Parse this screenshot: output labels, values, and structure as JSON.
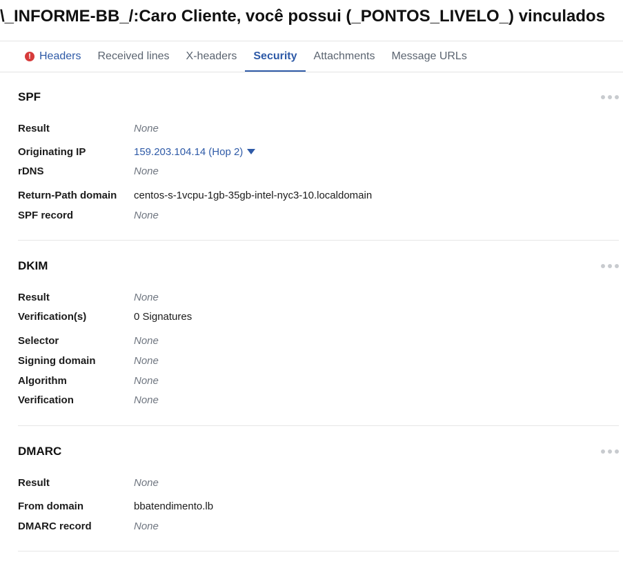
{
  "page_title": "\\_INFORME-BB_/:Caro Cliente, você possui (_PONTOS_LIVELO_) vinculados",
  "tabs": [
    {
      "label": "Headers",
      "icon": "alert-icon"
    },
    {
      "label": "Received lines"
    },
    {
      "label": "X-headers"
    },
    {
      "label": "Security",
      "active": true
    },
    {
      "label": "Attachments"
    },
    {
      "label": "Message URLs"
    }
  ],
  "alert_icon_glyph": "!",
  "spf": {
    "title": "SPF",
    "result_label": "Result",
    "result_value": "None",
    "originating_ip_label": "Originating IP",
    "originating_ip_value": "159.203.104.14",
    "originating_ip_hop": "(Hop 2)",
    "rdns_label": "rDNS",
    "rdns_value": "None",
    "return_path_label": "Return-Path domain",
    "return_path_value": "centos-s-1vcpu-1gb-35gb-intel-nyc3-10.localdomain",
    "spf_record_label": "SPF record",
    "spf_record_value": "None"
  },
  "dkim": {
    "title": "DKIM",
    "result_label": "Result",
    "result_value": "None",
    "verifications_label": "Verification(s)",
    "verifications_value": "0 Signatures",
    "selector_label": "Selector",
    "selector_value": "None",
    "signing_domain_label": "Signing domain",
    "signing_domain_value": "None",
    "algorithm_label": "Algorithm",
    "algorithm_value": "None",
    "verification_label": "Verification",
    "verification_value": "None"
  },
  "dmarc": {
    "title": "DMARC",
    "result_label": "Result",
    "result_value": "None",
    "from_domain_label": "From domain",
    "from_domain_value": "bbatendimento.lb",
    "dmarc_record_label": "DMARC record",
    "dmarc_record_value": "None"
  },
  "colors": {
    "accent": "#2e5aa7",
    "alert": "#d63b3b",
    "muted": "#6f7680"
  }
}
